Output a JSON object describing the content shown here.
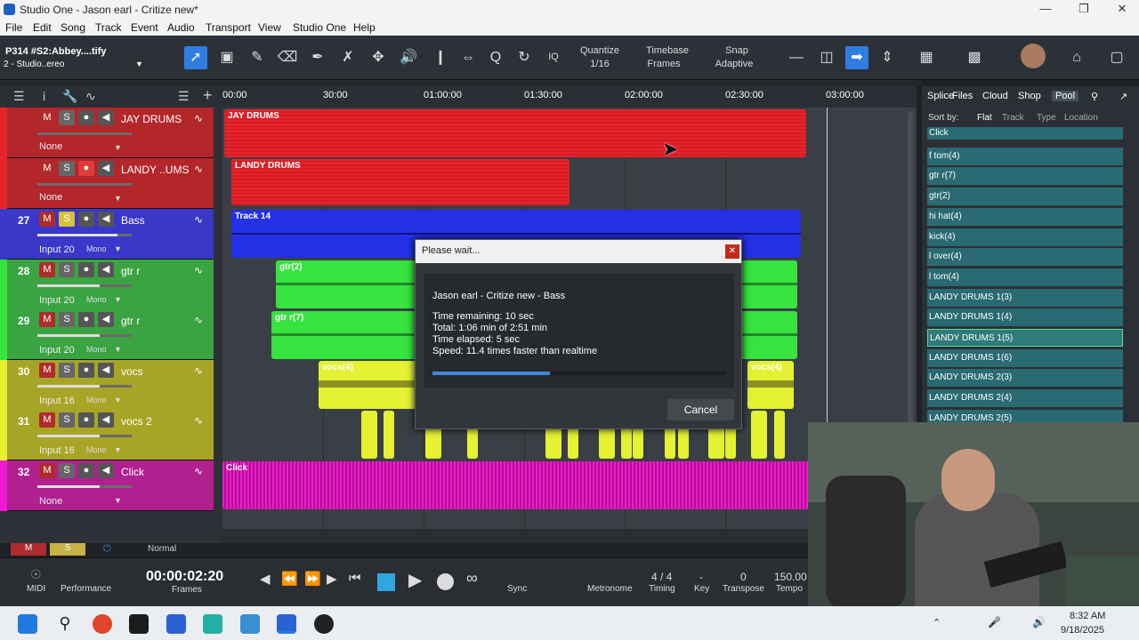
{
  "window": {
    "title": "Studio One - Jason earl - Critize new*"
  },
  "menu": [
    "File",
    "Edit",
    "Song",
    "Track",
    "Event",
    "Audio",
    "Transport",
    "View",
    "Studio One",
    "Help"
  ],
  "toolbar": {
    "preset_line1": "P314 #S2:Abbey....tify",
    "preset_line2": "2 - Studio..ereo",
    "iq": "IQ",
    "quantize_label": "Quantize",
    "quantize_value": "1/16",
    "timebase_label": "Timebase",
    "timebase_value": "Frames",
    "snap_label": "Snap",
    "snap_value": "Adaptive"
  },
  "ruler": [
    "00:00",
    "30:00",
    "01:00:00",
    "01:30:00",
    "02:00:00",
    "02:30:00",
    "03:00:00"
  ],
  "tracks": [
    {
      "num": "",
      "name": "JAY DRUMS",
      "input": "None",
      "color": "#b3262a"
    },
    {
      "num": "",
      "name": "LANDY ..UMS",
      "input": "None",
      "color": "#b3262a"
    },
    {
      "num": "27",
      "name": "Bass",
      "input": "Input 20",
      "mono": "Mono",
      "color": "#3a37c9"
    },
    {
      "num": "28",
      "name": "gtr r",
      "input": "Input 20",
      "mono": "Mono",
      "color": "#3aa443"
    },
    {
      "num": "29",
      "name": "gtr r",
      "input": "Input 20",
      "mono": "Mono",
      "color": "#3aa443"
    },
    {
      "num": "30",
      "name": "vocs",
      "input": "Input 16",
      "mono": "Mono",
      "color": "#a7a526"
    },
    {
      "num": "31",
      "name": "vocs 2",
      "input": "Input 16",
      "mono": "Mono",
      "color": "#a7a526"
    },
    {
      "num": "32",
      "name": "Click",
      "input": "None",
      "color": "#b0218f"
    }
  ],
  "clips": {
    "jay": "JAY DRUMS",
    "landy": "LANDY DRUMS",
    "track14": "Track 14",
    "gtr2": "gtr(2)",
    "gtrr7": "gtr r(7)",
    "vocs4a": "vocs(4)",
    "vocs4b": "vocs(4)",
    "click": "Click"
  },
  "dialog": {
    "title": "Please wait...",
    "heading": "Jason earl - Critize new - Bass",
    "remaining": "Time remaining: 10 sec",
    "total": "Total: 1:06 min of 2:51 min",
    "elapsed": "Time elapsed: 5 sec",
    "speed": "Speed: 11.4 times faster than realtime",
    "progress": 0.4,
    "cancel": "Cancel"
  },
  "browser": {
    "tabs": [
      "Splice",
      "Files",
      "Cloud",
      "Shop",
      "Pool"
    ],
    "sort_by": "Sort by:",
    "sort_opts": [
      "Flat",
      "Track",
      "Type",
      "Location"
    ],
    "items": [
      "Click",
      "f tom(4)",
      "gtr r(7)",
      "gtr(2)",
      "hi hat(4)",
      "kick(4)",
      "l over(4)",
      "l tom(4)",
      "LANDY DRUMS 1(3)",
      "LANDY DRUMS 1(4)",
      "LANDY DRUMS 1(5)",
      "LANDY DRUMS 1(6)",
      "LANDY DRUMS 2(3)",
      "LANDY DRUMS 2(4)",
      "LANDY DRUMS 2(5)"
    ],
    "selected_index": 10
  },
  "bottom": {
    "m": "M",
    "s": "S",
    "mode": "Normal"
  },
  "transport": {
    "midi": "MIDI",
    "performance": "Performance",
    "time": "00:00:02:20",
    "time_unit": "Frames",
    "sync": "Sync",
    "metronome": "Metronome",
    "timing_value": "4 / 4",
    "timing": "Timing",
    "key_value": "-",
    "key": "Key",
    "transpose_value": "0",
    "transpose": "Transpose",
    "tempo_value": "150.00",
    "tempo": "Tempo"
  },
  "taskbar": {
    "time": "8:32 AM",
    "date": "9/18/2025"
  }
}
